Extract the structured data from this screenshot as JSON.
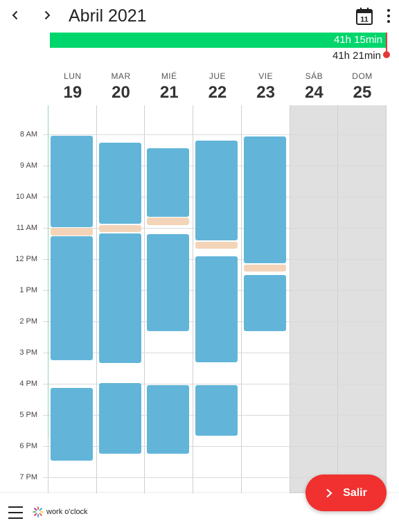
{
  "header": {
    "title": "Abril 2021",
    "calendar_icon_day": "11",
    "prev_icon": "chevron-left-icon",
    "next_icon": "chevron-right-icon",
    "more_icon": "more-vertical-icon"
  },
  "summary": {
    "worked": "41h 15min",
    "target": "41h 21min",
    "worked_fraction": 0.9976,
    "colors": {
      "worked": "#00d66b",
      "marker": "#e53935"
    }
  },
  "days": [
    {
      "name": "LUN",
      "num": "19",
      "weekend": false
    },
    {
      "name": "MAR",
      "num": "20",
      "weekend": false
    },
    {
      "name": "MIÉ",
      "num": "21",
      "weekend": false
    },
    {
      "name": "JUE",
      "num": "22",
      "weekend": false
    },
    {
      "name": "VIE",
      "num": "23",
      "weekend": false
    },
    {
      "name": "SÁB",
      "num": "24",
      "weekend": true
    },
    {
      "name": "DOM",
      "num": "25",
      "weekend": true
    }
  ],
  "hours": [
    "7 AM",
    "8 AM",
    "9 AM",
    "10 AM",
    "11 AM",
    "12 PM",
    "1 PM",
    "2 PM",
    "3 PM",
    "4 PM",
    "5 PM",
    "6 PM",
    "7 PM"
  ],
  "events": [
    {
      "day": 0,
      "start": "8:02",
      "end": "10:58",
      "type": "work"
    },
    {
      "day": 0,
      "start": "11:00",
      "end": "11:14",
      "type": "break"
    },
    {
      "day": 0,
      "start": "11:16",
      "end": "15:14",
      "type": "work"
    },
    {
      "day": 0,
      "start": "16:08",
      "end": "18:28",
      "type": "work"
    },
    {
      "day": 1,
      "start": "8:16",
      "end": "10:52",
      "type": "work"
    },
    {
      "day": 1,
      "start": "10:54",
      "end": "11:08",
      "type": "break"
    },
    {
      "day": 1,
      "start": "11:10",
      "end": "15:20",
      "type": "work"
    },
    {
      "day": 1,
      "start": "15:58",
      "end": "18:14",
      "type": "work"
    },
    {
      "day": 2,
      "start": "8:26",
      "end": "10:38",
      "type": "work"
    },
    {
      "day": 2,
      "start": "10:40",
      "end": "10:54",
      "type": "break"
    },
    {
      "day": 2,
      "start": "11:12",
      "end": "14:18",
      "type": "work"
    },
    {
      "day": 2,
      "start": "16:02",
      "end": "18:14",
      "type": "work"
    },
    {
      "day": 3,
      "start": "8:12",
      "end": "11:24",
      "type": "work"
    },
    {
      "day": 3,
      "start": "11:26",
      "end": "11:40",
      "type": "break"
    },
    {
      "day": 3,
      "start": "11:54",
      "end": "15:18",
      "type": "work"
    },
    {
      "day": 3,
      "start": "16:02",
      "end": "17:40",
      "type": "work"
    },
    {
      "day": 4,
      "start": "8:04",
      "end": "12:08",
      "type": "work"
    },
    {
      "day": 4,
      "start": "12:10",
      "end": "12:24",
      "type": "break"
    },
    {
      "day": 4,
      "start": "12:30",
      "end": "14:18",
      "type": "work"
    }
  ],
  "colors": {
    "work": "#62b5d9",
    "break": "#f3d4b8",
    "weekend": "#e0e0e0",
    "exit": "#f0312f"
  },
  "bottom": {
    "menu_icon": "hamburger-menu-icon",
    "logo_text": "work o'clock"
  },
  "fab": {
    "label": "Salir",
    "icon": "chevron-right-icon"
  }
}
